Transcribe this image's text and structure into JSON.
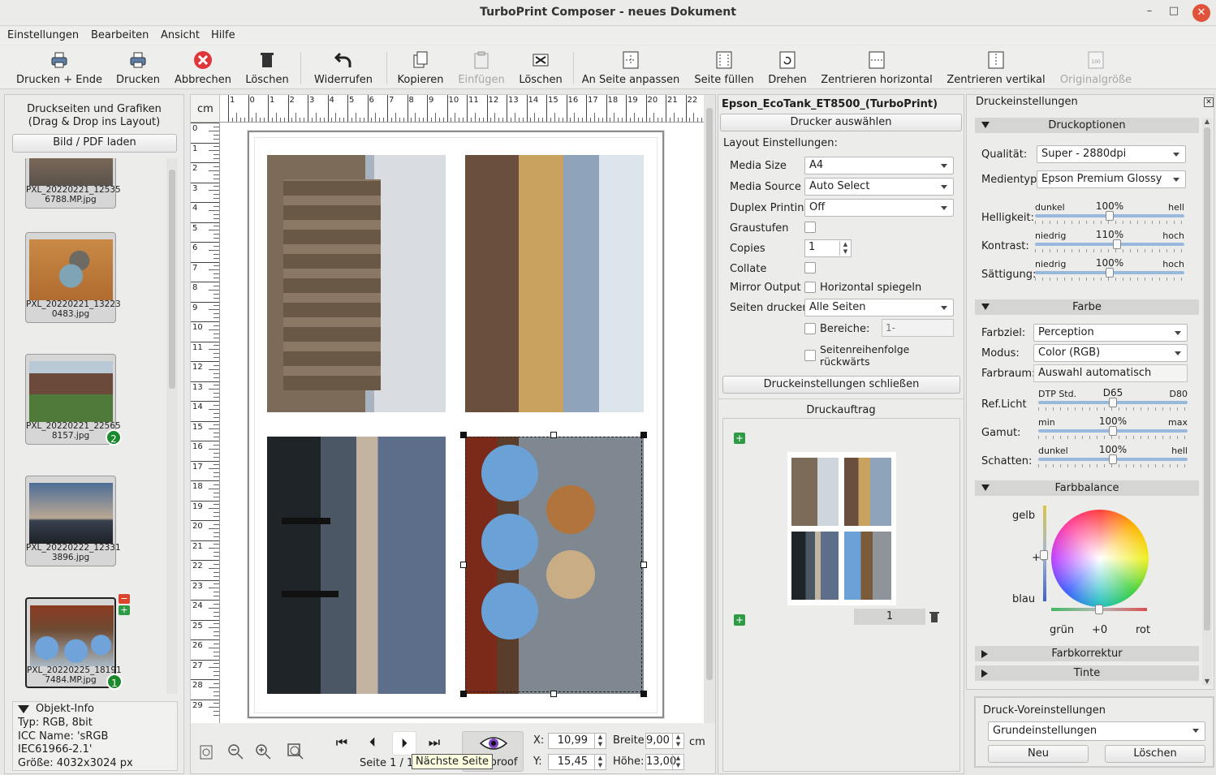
{
  "window": {
    "title": "TurboPrint Composer - neues Dokument",
    "min": "–",
    "max": "□",
    "close": "✕"
  },
  "menu": [
    "Einstellungen",
    "Bearbeiten",
    "Ansicht",
    "Hilfe"
  ],
  "toolbar": [
    "Drucken + Ende",
    "Drucken",
    "Abbrechen",
    "Löschen",
    "Widerrufen",
    "Kopieren",
    "Einfügen",
    "Löschen",
    "An Seite anpassen",
    "Seite füllen",
    "Drehen",
    "Zentrieren horizontal",
    "Zentrieren vertikal",
    "Originalgröße"
  ],
  "left": {
    "header": "Druckseiten und Grafiken\n(Drag & Drop ins Layout)",
    "load_button": "Bild / PDF laden",
    "thumbs": [
      {
        "cap1": "PXL_20220221_12535",
        "cap2": "6788.MP.jpg",
        "badge": ""
      },
      {
        "cap1": "PXL_20220221_13223",
        "cap2": "0483.jpg",
        "badge": ""
      },
      {
        "cap1": "PXL_20220221_22565",
        "cap2": "8157.jpg",
        "badge": "2"
      },
      {
        "cap1": "PXL_20220222_12331",
        "cap2": "3896.jpg",
        "badge": ""
      },
      {
        "cap1": "PXL_20220225_18191",
        "cap2": "7484.MP.jpg",
        "badge": "1"
      }
    ],
    "info": {
      "title": "Objekt-Info",
      "typ": "Typ: RGB, 8bit",
      "icc": "ICC Name: 'sRGB",
      "iec": "IEC61966-2.1'",
      "size": "Größe: 4032x3024 px"
    }
  },
  "ruler": {
    "unit": "cm",
    "h": [
      "1",
      "0",
      "1",
      "2",
      "3",
      "4",
      "5",
      "6",
      "7",
      "8",
      "9",
      "10",
      "11",
      "12",
      "13",
      "14",
      "15",
      "16",
      "17",
      "18",
      "19",
      "20",
      "21",
      "22"
    ],
    "v": [
      "0",
      "1",
      "2",
      "3",
      "4",
      "5",
      "6",
      "7",
      "8",
      "9",
      "10",
      "11",
      "12",
      "13",
      "14",
      "15",
      "16",
      "17",
      "18",
      "19",
      "20",
      "21",
      "22",
      "23",
      "24",
      "25",
      "26",
      "27",
      "28",
      "29"
    ]
  },
  "bottom": {
    "page": "Seite 1 / 1",
    "tooltip": "Nächste Seite",
    "softproof": "Softproof",
    "x_label": "X:",
    "x": "10,99",
    "y_label": "Y:",
    "y": "15,45",
    "w_label": "Breite:",
    "w": "9,00",
    "h_label": "Höhe:",
    "h": "13,00",
    "unit": "cm"
  },
  "printer": {
    "name": "Epson_EcoTank_ET8500_(TurboPrint)",
    "select": "Drucker auswählen",
    "layout_title": "Layout Einstellungen:",
    "media_size": {
      "label": "Media Size",
      "value": "A4"
    },
    "media_source": {
      "label": "Media Source",
      "value": "Auto Select"
    },
    "duplex": {
      "label": "Duplex Printing",
      "value": "Off"
    },
    "gray": "Graustufen",
    "copies": {
      "label": "Copies",
      "value": "1"
    },
    "collate": "Collate",
    "mirror": {
      "label": "Mirror Output",
      "value": "Horizontal spiegeln"
    },
    "pages": {
      "label": "Seiten drucken:",
      "value": "Alle Seiten"
    },
    "ranges": {
      "label": "Bereiche:",
      "placeholder": "1-"
    },
    "reverse": "Seitenreihenfolge\nrückwärts",
    "close": "Druckeinstellungen schließen",
    "job_title": "Druckauftrag",
    "job_count": "1"
  },
  "settings": {
    "title": "Druckeinstellungen",
    "options": {
      "title": "Druckoptionen",
      "quality_label": "Qualität:",
      "quality": "Super - 2880dpi",
      "media_label": "Medientyp:",
      "media": "Epson Premium Glossy",
      "sliders": [
        {
          "label": "Helligkeit:",
          "left": "dunkel",
          "value": "100%",
          "right": "hell",
          "pos": 0.5
        },
        {
          "label": "Kontrast:",
          "left": "niedrig",
          "value": "110%",
          "right": "hoch",
          "pos": 0.55
        },
        {
          "label": "Sättigung:",
          "left": "niedrig",
          "value": "100%",
          "right": "hoch",
          "pos": 0.5
        }
      ]
    },
    "color": {
      "title": "Farbe",
      "target_label": "Farbziel:",
      "target": "Perception",
      "mode_label": "Modus:",
      "mode": "Color (RGB)",
      "space_label": "Farbraum:",
      "space": "Auswahl automatisch",
      "sliders": [
        {
          "label": "Ref.Licht",
          "left": "DTP Std.",
          "value": "D65",
          "right": "D80",
          "pos": 0.5
        },
        {
          "label": "Gamut:",
          "left": "min",
          "value": "100%",
          "right": "max",
          "pos": 0.5
        },
        {
          "label": "Schatten:",
          "left": "dunkel",
          "value": "100%",
          "right": "hell",
          "pos": 0.5
        }
      ]
    },
    "balance": {
      "title": "Farbbalance",
      "top": "gelb",
      "mid": "+0",
      "bottom": "blau",
      "left": "grün",
      "center": "+0",
      "right": "rot"
    },
    "correction": "Farbkorrektur",
    "ink": "Tinte"
  },
  "presets": {
    "title": "Druck-Voreinstellungen",
    "value": "Grundeinstellungen",
    "new": "Neu",
    "delete": "Löschen"
  }
}
